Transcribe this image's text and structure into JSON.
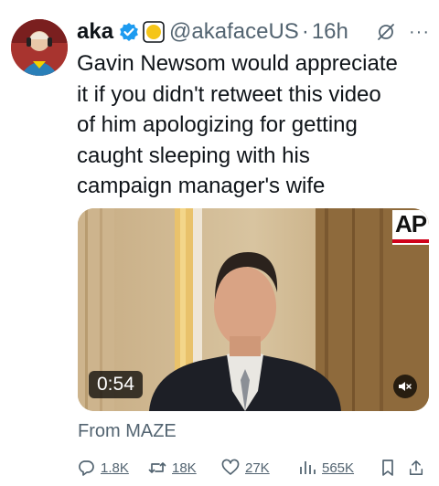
{
  "tweet": {
    "author_name": "aka",
    "handle": "@akafaceUS",
    "separator": "·",
    "time": "16h",
    "text": "Gavin Newsom would appreciate\nit if you didn't retweet this video\nof him apologizing for getting\ncaught sleeping with his\ncampaign manager's wife",
    "source": "From MAZE"
  },
  "media": {
    "duration": "0:54",
    "logo_text": "AP"
  },
  "actions": {
    "replies": "1.8K",
    "retweets": "18K",
    "likes": "27K",
    "views": "565K"
  },
  "colors": {
    "verified": "#1d9bf0",
    "affiliate_badge": "#f5c518",
    "secondary_text": "#536471",
    "ap_red": "#d0021b"
  },
  "icons": [
    "verified-badge-icon",
    "affiliation-badge-icon",
    "grok-icon",
    "more-icon",
    "mute-icon",
    "reply-icon",
    "retweet-icon",
    "like-icon",
    "views-icon",
    "bookmark-icon",
    "share-icon"
  ]
}
